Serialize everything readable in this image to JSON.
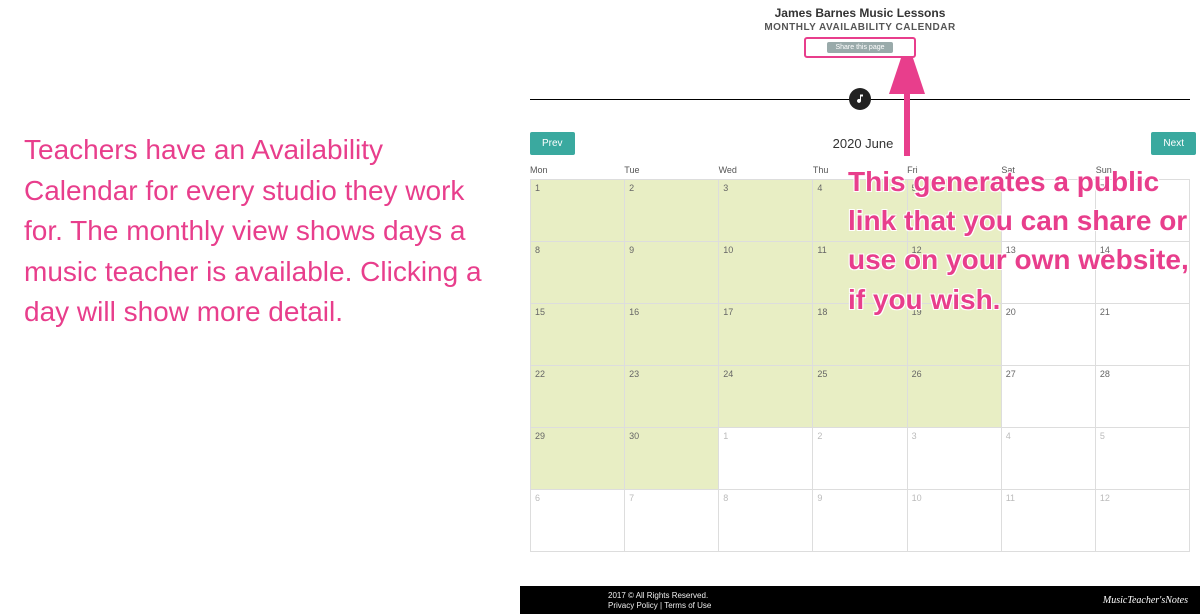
{
  "leftText": "Teachers have an Availability Calendar for every studio they work for. The monthly view shows days a music teacher is available. Clicking a day will show more detail.",
  "rightText": "This generates a public link that you can share or use on your own website, if you wish.",
  "header": {
    "studioName": "James Barnes Music Lessons",
    "calendarTitle": "MONTHLY AVAILABILITY CALENDAR",
    "shareLabel": "Share this page"
  },
  "nav": {
    "prev": "Prev",
    "next": "Next",
    "monthLabel": "2020 June"
  },
  "dayHeaders": [
    "Mon",
    "Tue",
    "Wed",
    "Thu",
    "Fri",
    "Sat",
    "Sun"
  ],
  "cells": [
    {
      "n": "1",
      "avail": true,
      "out": false
    },
    {
      "n": "2",
      "avail": true,
      "out": false
    },
    {
      "n": "3",
      "avail": true,
      "out": false
    },
    {
      "n": "4",
      "avail": true,
      "out": false
    },
    {
      "n": "5",
      "avail": true,
      "out": false
    },
    {
      "n": "6",
      "avail": false,
      "out": false
    },
    {
      "n": "7",
      "avail": false,
      "out": false
    },
    {
      "n": "8",
      "avail": true,
      "out": false
    },
    {
      "n": "9",
      "avail": true,
      "out": false
    },
    {
      "n": "10",
      "avail": true,
      "out": false
    },
    {
      "n": "11",
      "avail": true,
      "out": false
    },
    {
      "n": "12",
      "avail": true,
      "out": false
    },
    {
      "n": "13",
      "avail": false,
      "out": false
    },
    {
      "n": "14",
      "avail": false,
      "out": false
    },
    {
      "n": "15",
      "avail": true,
      "out": false
    },
    {
      "n": "16",
      "avail": true,
      "out": false
    },
    {
      "n": "17",
      "avail": true,
      "out": false
    },
    {
      "n": "18",
      "avail": true,
      "out": false
    },
    {
      "n": "19",
      "avail": true,
      "out": false
    },
    {
      "n": "20",
      "avail": false,
      "out": false
    },
    {
      "n": "21",
      "avail": false,
      "out": false
    },
    {
      "n": "22",
      "avail": true,
      "out": false
    },
    {
      "n": "23",
      "avail": true,
      "out": false
    },
    {
      "n": "24",
      "avail": true,
      "out": false
    },
    {
      "n": "25",
      "avail": true,
      "out": false
    },
    {
      "n": "26",
      "avail": true,
      "out": false
    },
    {
      "n": "27",
      "avail": false,
      "out": false
    },
    {
      "n": "28",
      "avail": false,
      "out": false
    },
    {
      "n": "29",
      "avail": true,
      "out": false
    },
    {
      "n": "30",
      "avail": true,
      "out": false
    },
    {
      "n": "1",
      "avail": true,
      "out": true
    },
    {
      "n": "2",
      "avail": true,
      "out": true
    },
    {
      "n": "3",
      "avail": true,
      "out": true
    },
    {
      "n": "4",
      "avail": false,
      "out": true
    },
    {
      "n": "5",
      "avail": false,
      "out": true
    },
    {
      "n": "6",
      "avail": true,
      "out": true
    },
    {
      "n": "7",
      "avail": true,
      "out": true
    },
    {
      "n": "8",
      "avail": true,
      "out": true
    },
    {
      "n": "9",
      "avail": true,
      "out": true
    },
    {
      "n": "10",
      "avail": true,
      "out": true
    },
    {
      "n": "11",
      "avail": false,
      "out": true
    },
    {
      "n": "12",
      "avail": false,
      "out": true
    }
  ],
  "footer": {
    "copyright": "2017 © All Rights Reserved.",
    "privacy": "Privacy Policy",
    "separator": "|",
    "terms": "Terms of Use",
    "logo": "MusicTeacher'sNotes"
  }
}
